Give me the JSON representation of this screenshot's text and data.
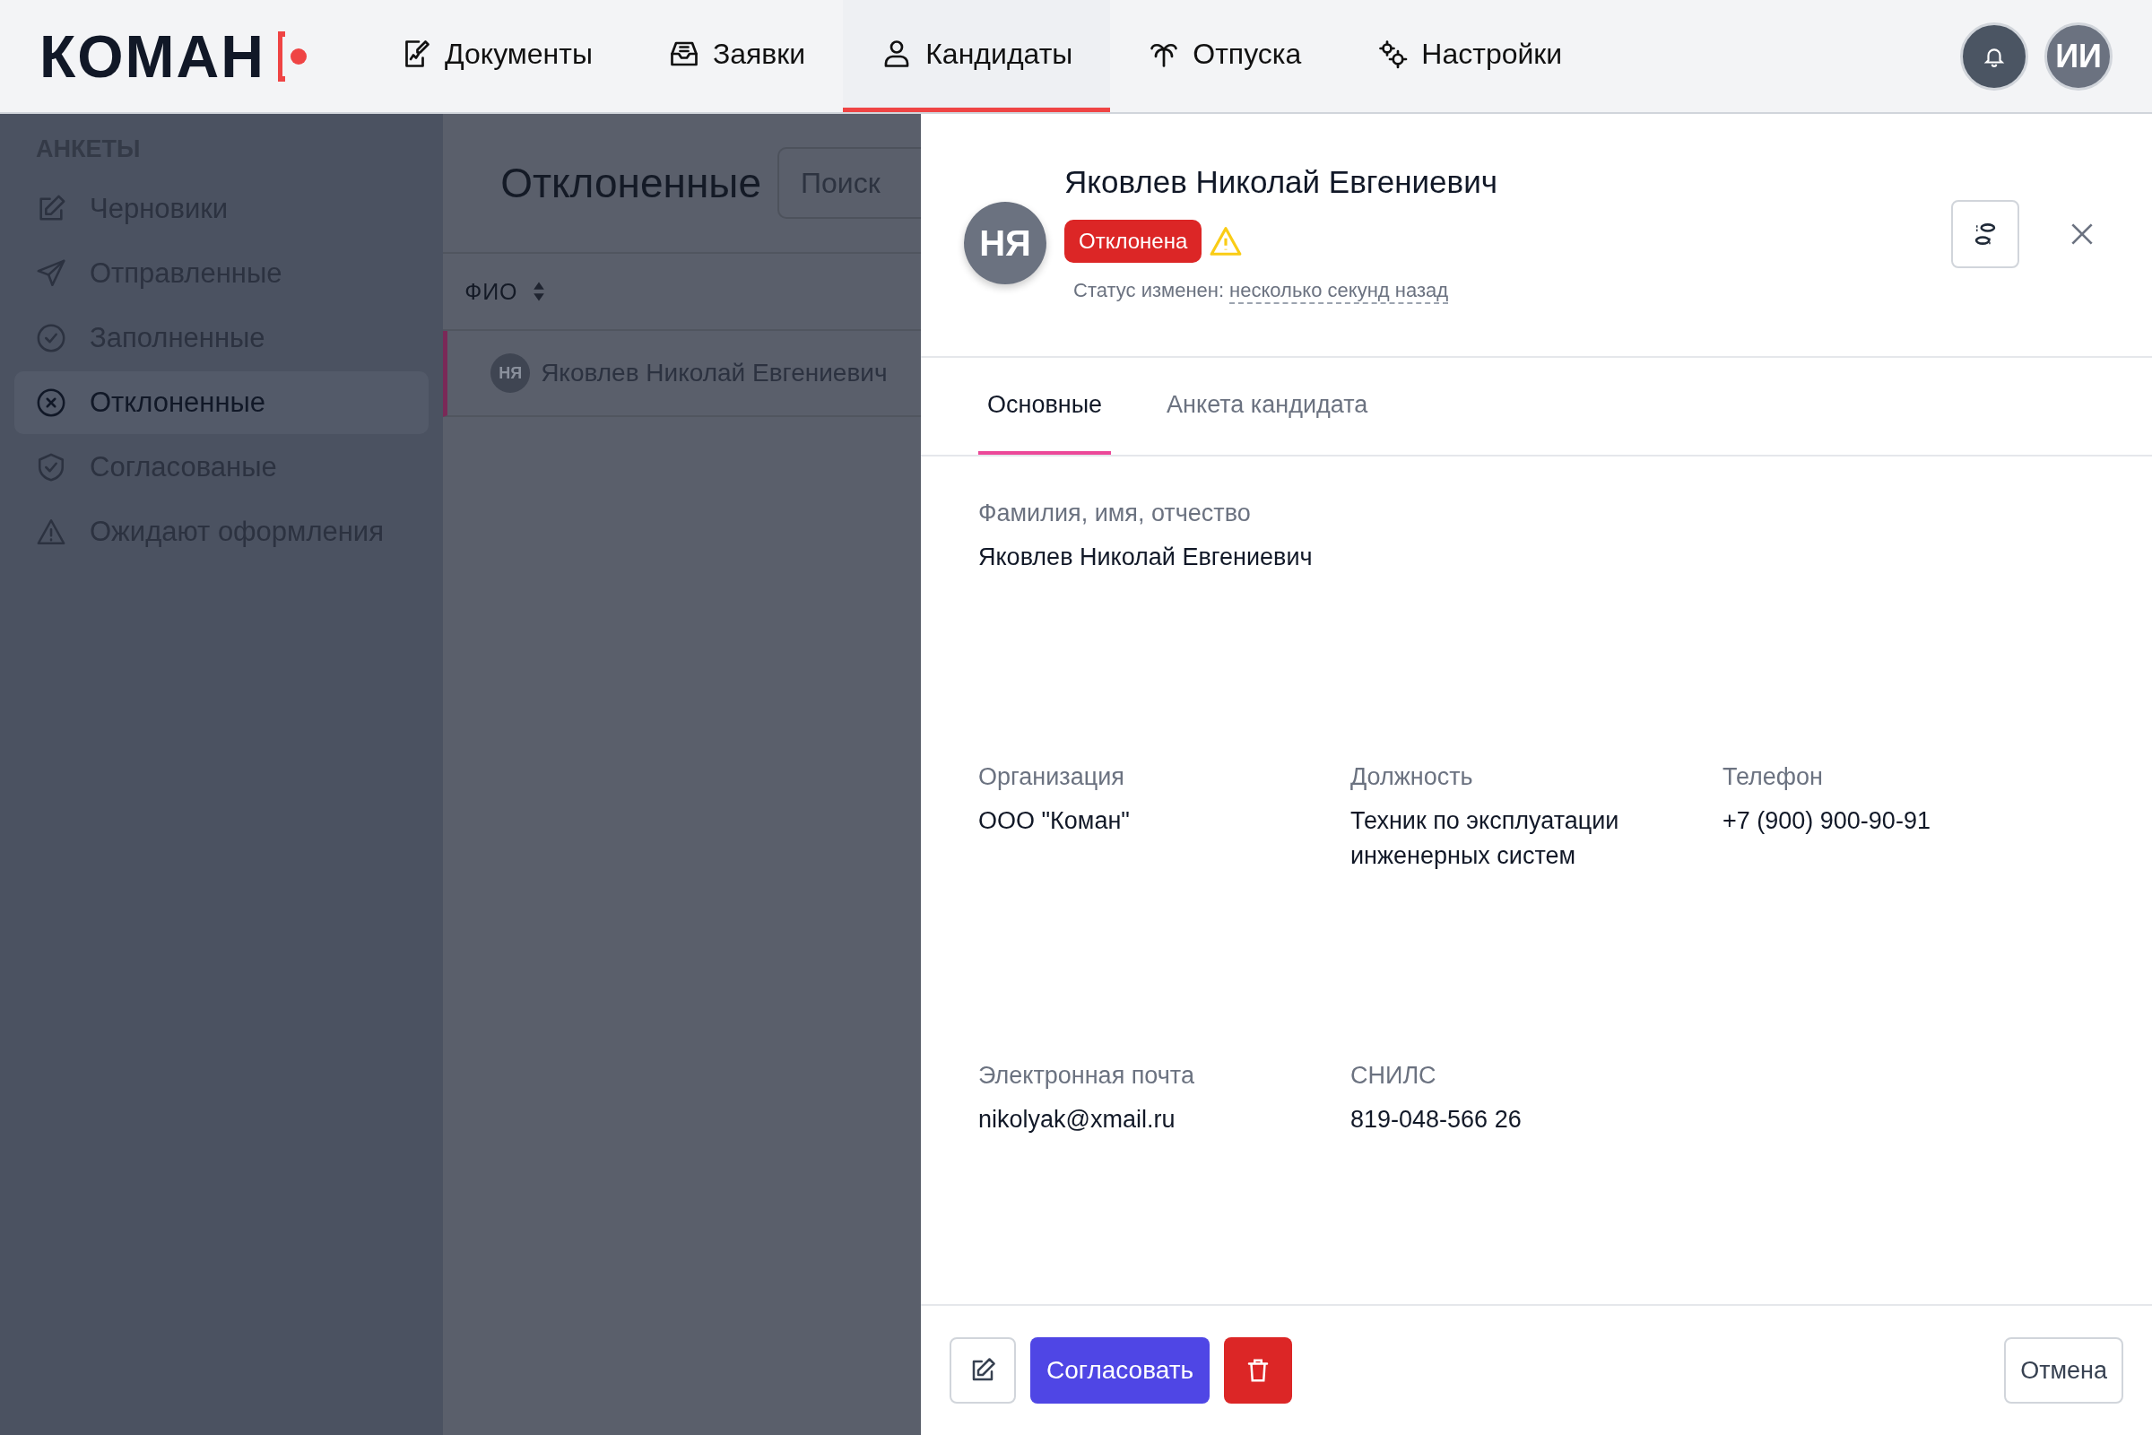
{
  "header": {
    "logo": "КОМАН",
    "nav": [
      {
        "label": "Документы",
        "selected": false
      },
      {
        "label": "Заявки",
        "selected": false
      },
      {
        "label": "Кандидаты",
        "selected": true
      },
      {
        "label": "Отпуска",
        "selected": false
      },
      {
        "label": "Настройки",
        "selected": false
      }
    ],
    "avatar": "ИИ"
  },
  "sidebar": {
    "heading": "АНКЕТЫ",
    "items": [
      {
        "label": "Черновики",
        "selected": false
      },
      {
        "label": "Отправленные",
        "selected": false
      },
      {
        "label": "Заполненные",
        "selected": false
      },
      {
        "label": "Отклоненные",
        "selected": true
      },
      {
        "label": "Согласованые",
        "selected": false
      },
      {
        "label": "Ожидают оформления",
        "selected": false
      }
    ]
  },
  "list": {
    "title": "Отклоненные",
    "search": {
      "placeholder": "Поиск"
    },
    "column": "ФИО",
    "rows": [
      {
        "initials": "НЯ",
        "name": "Яковлев Николай Евгениевич",
        "selected": true
      }
    ]
  },
  "drawer": {
    "initials": "НЯ",
    "name": "Яковлев Николай Евгениевич",
    "status": "Отклонена",
    "status_label": "Статус изменен:",
    "status_time": "несколько секунд назад",
    "tabs": [
      {
        "label": "Основные",
        "selected": true
      },
      {
        "label": "Анкета кандидата",
        "selected": false
      }
    ],
    "field_rows": [
      [
        {
          "label": "Фамилия, имя, отчество",
          "value": "Яковлев Николай Евгениевич"
        }
      ],
      [
        {
          "label": "Организация",
          "value": "ООО \"Коман\""
        },
        {
          "label": "Должность",
          "value": "Техник по эксплуатации инженерных систем"
        },
        {
          "label": "Телефон",
          "value": "+7 (900) 900-90-91"
        }
      ],
      [
        {
          "label": "Электронная почта",
          "value": "nikolyak@xmail.ru"
        },
        {
          "label": "СНИЛС",
          "value": "819-048-566 26"
        }
      ]
    ],
    "buttons": {
      "approve": "Согласовать",
      "cancel": "Отмена"
    }
  }
}
